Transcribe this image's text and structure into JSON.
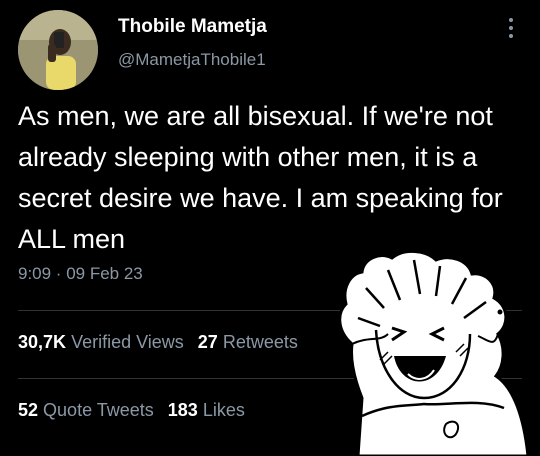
{
  "author": {
    "display_name": "Thobile Mametja",
    "handle": "@MametjaThobile1"
  },
  "tweet": {
    "text": "As men, we are all bisexual. If we're not already sleeping with other men, it is a secret desire we have. I am speaking for ALL men",
    "timestamp": "9:09 · 09 Feb 23"
  },
  "stats": {
    "views_count": "30,7K",
    "views_label": "Verified Views",
    "retweets_count": "27",
    "retweets_label": "Retweets",
    "quotes_count": "52",
    "quotes_label": "Quote Tweets",
    "likes_count": "183",
    "likes_label": "Likes"
  },
  "icons": {
    "more": "more-options-icon",
    "sticker": "laughing-cartoon-sticker"
  },
  "colors": {
    "background": "#000000",
    "primary_text": "#ffffff",
    "secondary_text": "#8b98a5"
  }
}
